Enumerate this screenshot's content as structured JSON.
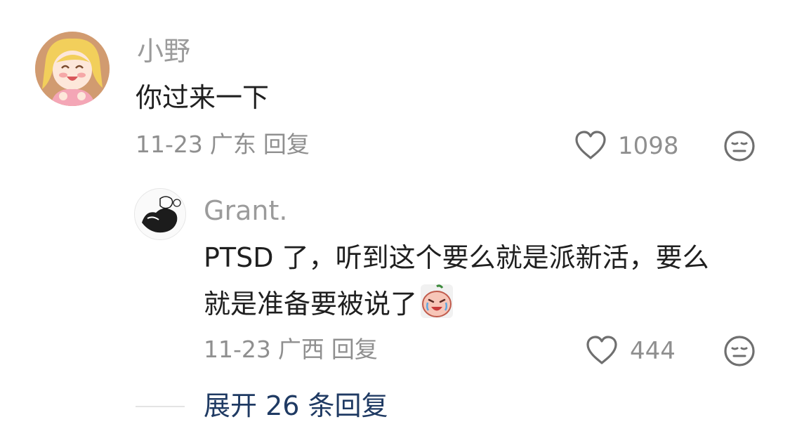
{
  "comments": [
    {
      "username": "小野",
      "text": "你过来一下",
      "date": "11-23",
      "location": "广东",
      "reply_label": "回复",
      "likes": "1098"
    }
  ],
  "reply": {
    "username": "Grant.",
    "text_line1": "PTSD 了，听到这个要么就是派新活，要么",
    "text_line2": "就是准备要被说了",
    "emoji": "crying-face-emoji",
    "date": "11-23",
    "location": "广西",
    "reply_label": "回复",
    "likes": "444"
  },
  "expand_label": "展开 26 条回复",
  "icons": {
    "like": "heart-outline-icon",
    "dislike": "neutral-face-icon"
  },
  "colors": {
    "accent_link": "#1f3a63",
    "meta_gray": "#8f8f8f"
  }
}
